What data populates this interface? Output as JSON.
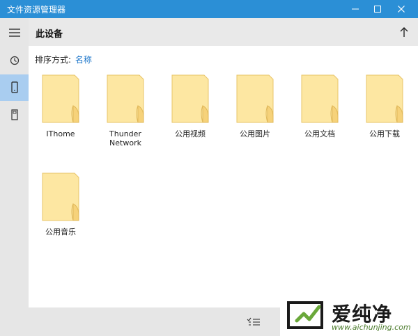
{
  "window": {
    "title": "文件资源管理器",
    "accent": "#2b8fd6"
  },
  "window_controls": {
    "icons": [
      "minimize-icon",
      "maximize-icon",
      "close-icon"
    ]
  },
  "nav_rail": {
    "items": [
      {
        "icon": "hamburger-menu-icon",
        "active": false
      },
      {
        "icon": "recent-clock-icon",
        "active": false
      },
      {
        "icon": "this-device-icon",
        "active": true
      },
      {
        "icon": "sd-card-icon",
        "active": false
      }
    ],
    "active_color": "#a9cdf0"
  },
  "header": {
    "title": "此设备",
    "up_icon": "up-arrow-icon"
  },
  "sort": {
    "label": "排序方式:",
    "value": "名称",
    "value_color": "#1a74c9"
  },
  "folders": [
    {
      "name": "IThome"
    },
    {
      "name": "Thunder\nNetwork"
    },
    {
      "name": "公用视频"
    },
    {
      "name": "公用图片"
    },
    {
      "name": "公用文档"
    },
    {
      "name": "公用下载"
    },
    {
      "name": "公用音乐"
    }
  ],
  "bottom_bar": {
    "select_icon": "multi-select-icon"
  },
  "watermark": {
    "text": "爱纯净",
    "url": "www.aichunjing.com"
  }
}
